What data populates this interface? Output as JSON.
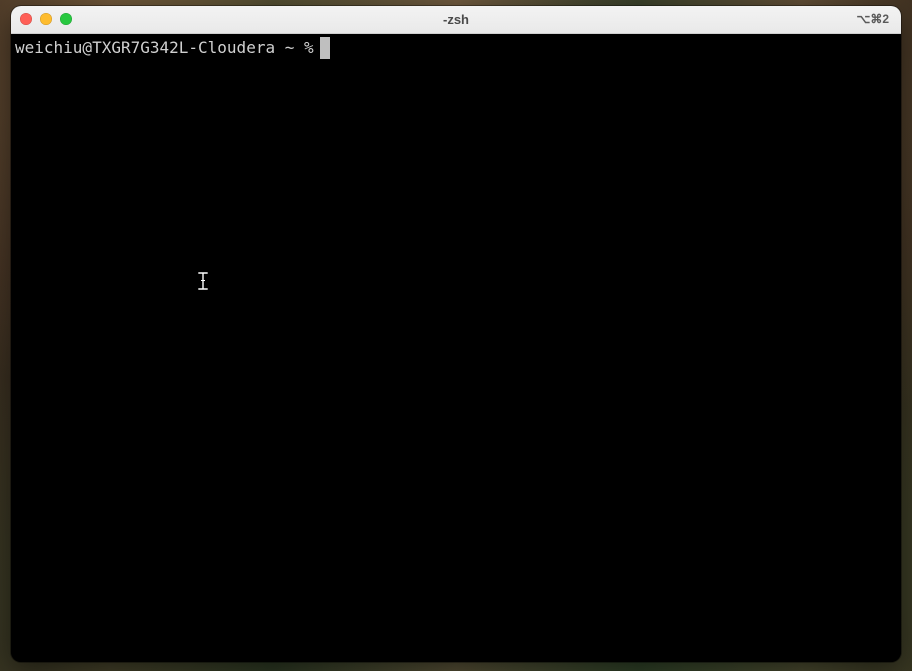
{
  "window": {
    "title": "-zsh",
    "shortcut": "⌥⌘2",
    "controls": [
      "close",
      "minimize",
      "zoom"
    ]
  },
  "terminal": {
    "prompt": "weichiu@TXGR7G342L-Cloudera ~ %",
    "cursor": "block"
  },
  "icons": {
    "mouse_pointer": "ibeam-cursor-icon"
  },
  "colors": {
    "terminal_bg": "#000000",
    "terminal_text": "#d0d0d0",
    "close": "#ff5f57",
    "minimize": "#febc2e",
    "zoom": "#28c840"
  }
}
